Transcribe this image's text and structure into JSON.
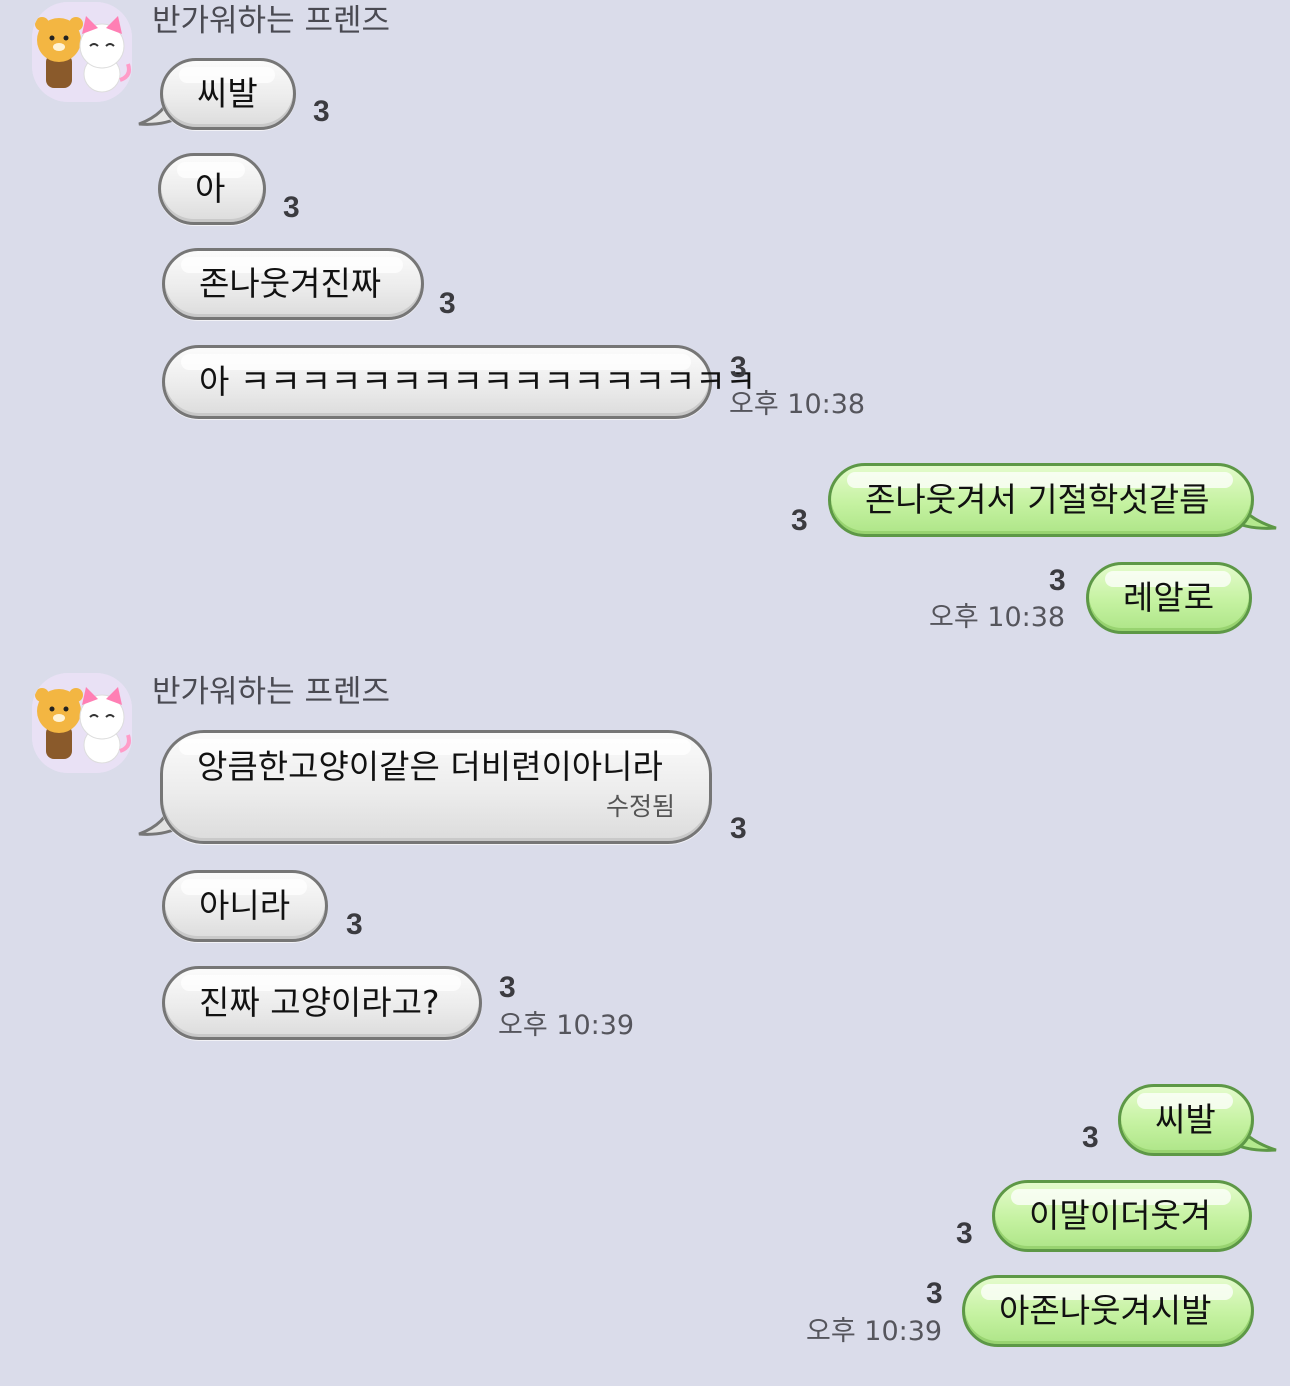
{
  "sender_name": "반가워하는 프렌즈",
  "unread_count": "3",
  "colors": {
    "background": "#dadcea",
    "incoming_bubble": "#ececec",
    "outgoing_bubble": "#c5f2a1",
    "outgoing_border": "#5d9846"
  },
  "groups": [
    {
      "direction": "incoming",
      "sender": "반가워하는 프렌즈",
      "messages": [
        {
          "text": "씨발",
          "unread": "3"
        },
        {
          "text": "아",
          "unread": "3"
        },
        {
          "text": "존나웃겨진짜",
          "unread": "3"
        },
        {
          "text": "아 ㅋㅋㅋㅋㅋㅋㅋㅋㅋㅋㅋㅋㅋㅋㅋㅋㅋ",
          "unread": "3",
          "time": "오후 10:38"
        }
      ]
    },
    {
      "direction": "outgoing",
      "messages": [
        {
          "text": "존나웃겨서 기절학섯같름",
          "unread": "3"
        },
        {
          "text": "레알로",
          "unread": "3",
          "time": "오후 10:38"
        }
      ]
    },
    {
      "direction": "incoming",
      "sender": "반가워하는 프렌즈",
      "messages": [
        {
          "text": "앙큼한고양이같은 더비련이아니라",
          "edited_label": "수정됨",
          "unread": "3"
        },
        {
          "text": "아니라",
          "unread": "3"
        },
        {
          "text": "진짜 고양이라고?",
          "unread": "3",
          "time": "오후 10:39"
        }
      ]
    },
    {
      "direction": "outgoing",
      "messages": [
        {
          "text": "씨발",
          "unread": "3"
        },
        {
          "text": "이말이더웃겨",
          "unread": "3"
        },
        {
          "text": "아존나웃겨시발",
          "unread": "3",
          "time": "오후 10:39"
        }
      ]
    }
  ]
}
